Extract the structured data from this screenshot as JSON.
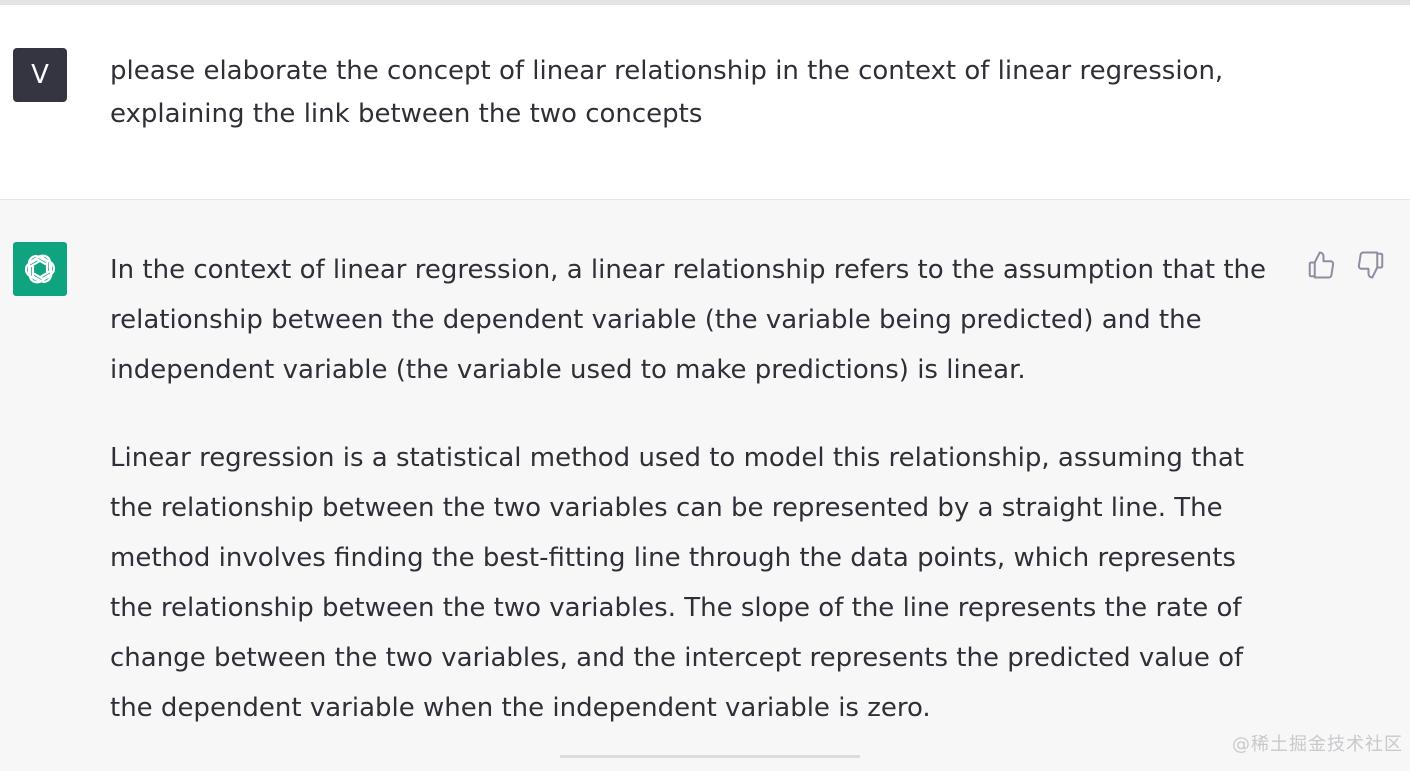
{
  "user_message": {
    "avatar_letter": "V",
    "text": "please elaborate the concept of linear relationship in the context of linear regression, explaining the link between the two concepts"
  },
  "assistant_message": {
    "avatar_icon": "openai-logo-icon",
    "paragraphs": [
      "In the context of linear regression, a linear relationship refers to the assumption that the relationship between the dependent variable (the variable being predicted) and the independent variable (the variable used to make predictions) is linear.",
      "Linear regression is a statistical method used to model this relationship, assuming that the relationship between the two variables can be represented by a straight line. The method involves finding the best-fitting line through the data points, which represents the relationship between the two variables. The slope of the line represents the rate of change between the two variables, and the intercept represents the predicted value of the dependent variable when the independent variable is zero."
    ],
    "feedback": {
      "like_icon": "thumbs-up-icon",
      "dislike_icon": "thumbs-down-icon"
    }
  },
  "watermark": "@稀土掘金技术社区",
  "colors": {
    "user_bg": "#ffffff",
    "assistant_bg": "#f7f7f8",
    "user_avatar_bg": "#343541",
    "bot_avatar_bg": "#10a37f",
    "text": "#2f2f37"
  }
}
